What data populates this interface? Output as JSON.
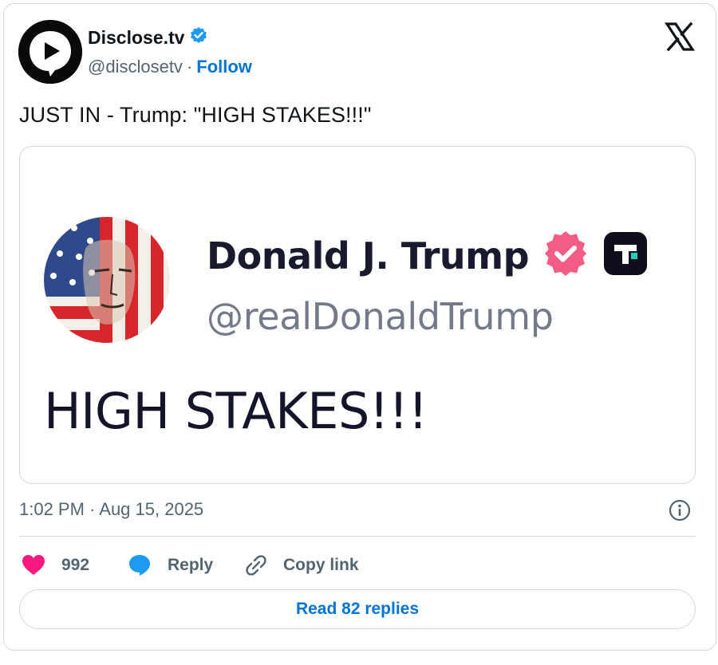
{
  "header": {
    "display_name": "Disclose.tv",
    "handle": "@disclosetv",
    "separator": "·",
    "follow_label": "Follow",
    "avatar_icon": "play-bubble-icon",
    "verified_icon": "verified-badge-icon",
    "platform_icon": "x-logo-icon"
  },
  "tweet": {
    "text": "JUST IN - Trump: \"HIGH STAKES!!!\""
  },
  "media": {
    "author_name": "Donald J. Trump",
    "author_handle": "@realDonaldTrump",
    "post_text": "HIGH STAKES!!!",
    "badge_icon": "verified-badge-icon",
    "app_icon": "truth-social-icon"
  },
  "meta": {
    "timestamp": "1:02 PM · Aug 15, 2025",
    "info_icon": "info-icon"
  },
  "actions": {
    "like_count": "992",
    "reply_label": "Reply",
    "copy_link_label": "Copy link"
  },
  "footer": {
    "read_replies_label": "Read 82 replies"
  },
  "colors": {
    "link_blue": "#0074d4",
    "verified_blue": "#1d9bf0",
    "like_pink": "#f91880",
    "secondary_text": "#536471",
    "border": "#cfd9de",
    "truth_badge_pink": "#f25d85"
  }
}
